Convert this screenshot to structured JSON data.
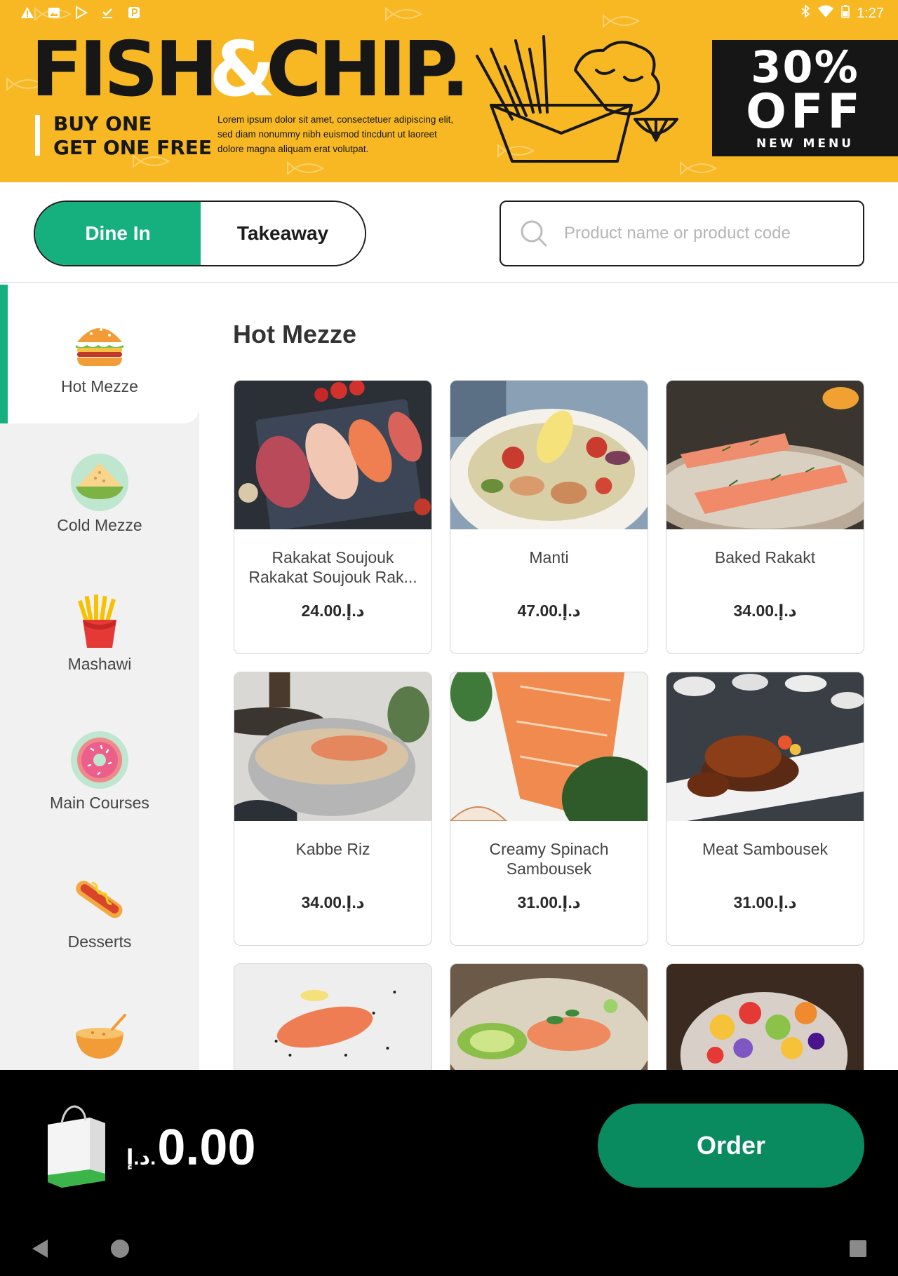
{
  "status_bar": {
    "time": "1:27",
    "left_icons": [
      "warning-icon",
      "image-icon",
      "play-store-icon",
      "download-done-icon",
      "parking-icon"
    ],
    "right_icons": [
      "bluetooth-icon",
      "wifi-icon",
      "battery-icon"
    ]
  },
  "banner": {
    "brand_part1": "FISH",
    "brand_amp": "&",
    "brand_part2": "CHIP.",
    "promo_line1": "BUY ONE",
    "promo_line2": "GET ONE FREE",
    "lorem": "Lorem ipsum dolor sit amet, consectetuer adipiscing elit, sed diam nonummy nibh euismod tincdunt ut laoreet dolore magna aliquam erat volutpat.",
    "discount": "30%",
    "off_label": "OFF",
    "new_menu": "NEW MENU",
    "colors": {
      "background": "#f7b824",
      "dark": "#161616"
    }
  },
  "order_type": {
    "dine_in": "Dine In",
    "takeaway": "Takeaway",
    "selected": "Dine In"
  },
  "search": {
    "placeholder": "Product name or product code",
    "value": ""
  },
  "categories": [
    {
      "label": "Hot Mezze",
      "icon": "burger-icon",
      "active": true
    },
    {
      "label": "Cold Mezze",
      "icon": "pizza-icon",
      "active": false
    },
    {
      "label": "Mashawi",
      "icon": "fries-icon",
      "active": false
    },
    {
      "label": "Main Courses",
      "icon": "donut-icon",
      "active": false
    },
    {
      "label": "Desserts",
      "icon": "hotdog-icon",
      "active": false
    },
    {
      "label": "",
      "icon": "soup-bowl-icon",
      "active": false
    }
  ],
  "section_title": "Hot Mezze",
  "currency": "د.إ.",
  "products": [
    {
      "name": "Rakakat Soujouk",
      "name_line2": "Rakakat Soujouk Rak...",
      "price": "د.إ.24.00"
    },
    {
      "name": "Manti",
      "name_line2": "",
      "price": "د.إ.47.00"
    },
    {
      "name": "Baked Rakakt",
      "name_line2": "",
      "price": "د.إ.34.00"
    },
    {
      "name": "Kabbe Riz",
      "name_line2": "",
      "price": "د.إ.34.00"
    },
    {
      "name": "Creamy Spinach",
      "name_line2": "Sambousek",
      "price": "د.إ.31.00"
    },
    {
      "name": "Meat Sambousek",
      "name_line2": "",
      "price": "د.إ.31.00"
    },
    {
      "name": "",
      "name_line2": "",
      "price": ""
    },
    {
      "name": "",
      "name_line2": "",
      "price": ""
    },
    {
      "name": "",
      "name_line2": "",
      "price": ""
    }
  ],
  "cart": {
    "currency": "د.إ.",
    "total": "0.00",
    "order_label": "Order"
  },
  "theme": {
    "accent": "#16b07f",
    "order_button": "#0a8a5f"
  }
}
